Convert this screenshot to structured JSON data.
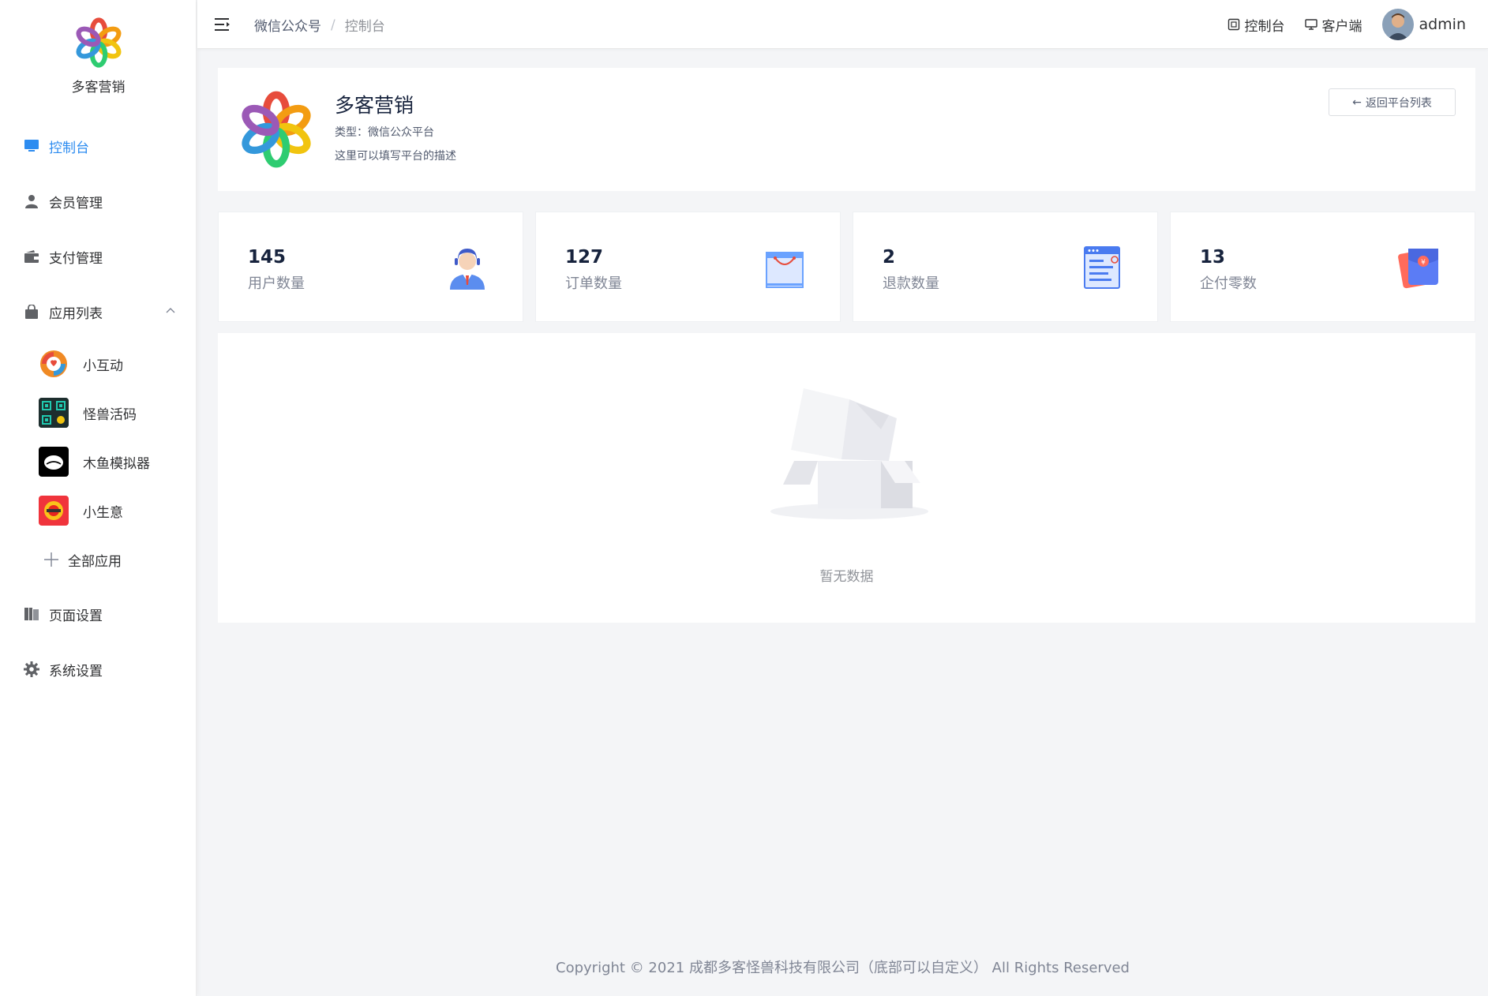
{
  "brand": {
    "name": "多客营销"
  },
  "sidebar": {
    "items": [
      {
        "label": "控制台",
        "icon": "monitor-icon",
        "active": true
      },
      {
        "label": "会员管理",
        "icon": "user-icon"
      },
      {
        "label": "支付管理",
        "icon": "wallet-icon"
      },
      {
        "label": "应用列表",
        "icon": "bag-icon",
        "expanded": true
      }
    ],
    "apps": [
      {
        "label": "小互动",
        "icon": "interaction-app-icon"
      },
      {
        "label": "怪兽活码",
        "icon": "qrcode-app-icon"
      },
      {
        "label": "木鱼模拟器",
        "icon": "muyu-app-icon"
      },
      {
        "label": "小生意",
        "icon": "business-app-icon"
      }
    ],
    "all_apps": "全部应用",
    "bottom_items": [
      {
        "label": "页面设置",
        "icon": "book-icon"
      },
      {
        "label": "系统设置",
        "icon": "gear-icon"
      }
    ]
  },
  "header": {
    "breadcrumb": [
      "微信公众号",
      "控制台"
    ],
    "links": [
      {
        "label": "控制台",
        "icon": "dashboard-icon"
      },
      {
        "label": "客户端",
        "icon": "desktop-icon"
      }
    ],
    "user": "admin"
  },
  "platform": {
    "title": "多客营销",
    "type": "类型：微信公众平台",
    "description": "这里可以填写平台的描述",
    "back_label": "返回平台列表"
  },
  "stats": [
    {
      "value": "145",
      "label": "用户数量",
      "icon": "user-avatar-icon"
    },
    {
      "value": "127",
      "label": "订单数量",
      "icon": "shopping-bag-icon"
    },
    {
      "value": "2",
      "label": "退款数量",
      "icon": "document-icon"
    },
    {
      "value": "13",
      "label": "企付零数",
      "icon": "red-packet-icon"
    }
  ],
  "empty": {
    "text": "暂无数据"
  },
  "footer": {
    "text": "Copyright © 2021 成都多客怪兽科技有限公司（底部可以自定义） All Rights Reserved"
  },
  "colors": {
    "accent": "#2d8cf0",
    "background": "#f4f5f7"
  }
}
